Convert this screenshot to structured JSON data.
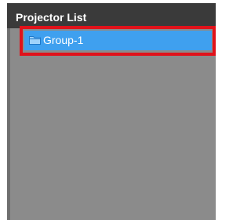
{
  "panel": {
    "title": "Projector List"
  },
  "tree": {
    "items": [
      {
        "label": "Group-1",
        "icon": "folder-icon",
        "selected": true
      }
    ]
  },
  "colors": {
    "header_bg": "#3a3a3a",
    "list_bg": "#8b8b8b",
    "selection_bg": "#3fa0ef",
    "highlight_border": "#e0121a"
  }
}
